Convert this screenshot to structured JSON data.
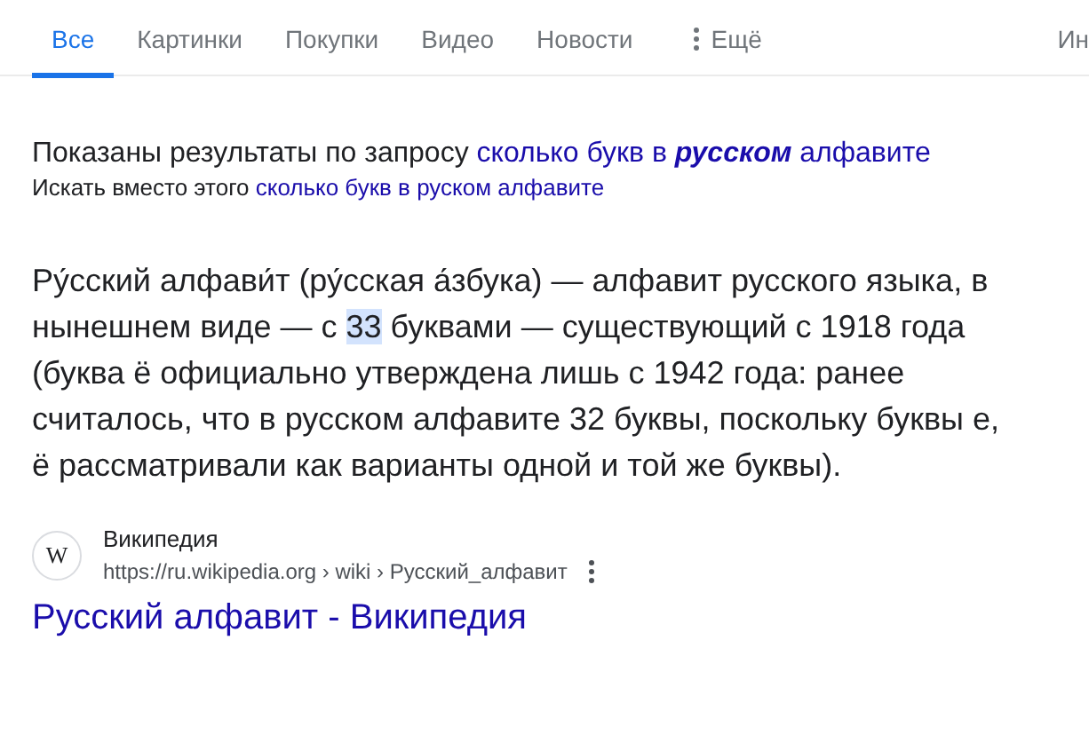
{
  "tabs": [
    {
      "label": "Все",
      "selected": true,
      "kind": "tab"
    },
    {
      "label": "Картинки",
      "selected": false,
      "kind": "tab"
    },
    {
      "label": "Покупки",
      "selected": false,
      "kind": "tab"
    },
    {
      "label": "Видео",
      "selected": false,
      "kind": "tab"
    },
    {
      "label": "Новости",
      "selected": false,
      "kind": "tab"
    },
    {
      "label": "Ещё",
      "selected": false,
      "kind": "more"
    },
    {
      "label": "Ин",
      "selected": false,
      "kind": "tab"
    }
  ],
  "correction": {
    "shown_text": "Показаны результаты по запросу",
    "shown_link": "сколько букв в **русском** алфавите",
    "instead_text": "Искать вместо этого",
    "instead_link": "сколько букв в руском алфавите"
  },
  "snippet": [
    {
      "text": "Ру́сский алфави́т (ру́сская а́збука) — алфавит русского языка, в нынешнем виде — с ",
      "highlighted": false
    },
    {
      "text": "33",
      "highlighted": true
    },
    {
      "text": " буквами — существующий с 1918 года (буква ё официально утверждена лишь с 1942 года: ранее считалось, что в русском алфавите 32 буквы, поскольку буквы е, ё рассматривали как варианты одной и той же буквы).",
      "highlighted": false
    }
  ],
  "source": {
    "favicon": "W",
    "site": "Википедия",
    "url": "https://ru.wikipedia.org › wiki › Русский_алфавит",
    "title": "Русский алфавит - Википедия"
  }
}
